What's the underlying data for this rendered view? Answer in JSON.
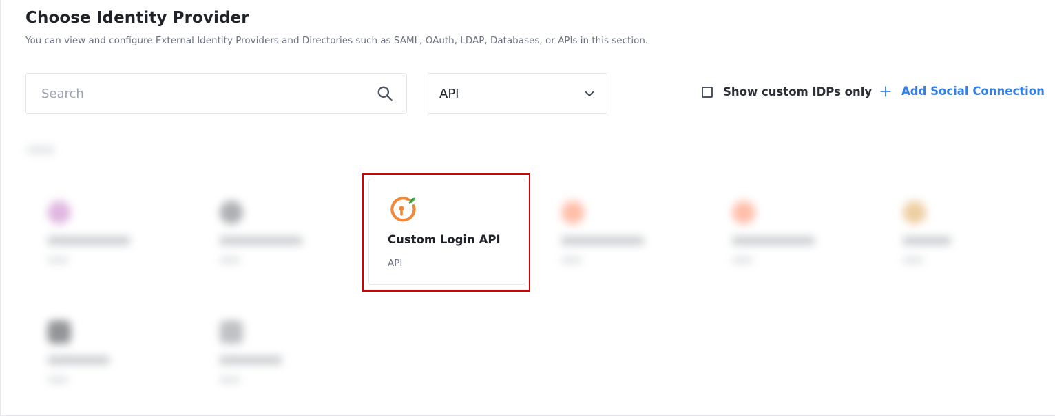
{
  "header": {
    "title": "Choose Identity Provider",
    "subtitle": "You can view and configure External Identity Providers and Directories such as SAML, OAuth, LDAP, Databases, or APIs in this section."
  },
  "toolbar": {
    "search": {
      "placeholder": "Search",
      "value": "",
      "icon": "search-icon"
    },
    "type_filter": {
      "selected": "API",
      "icon": "chevron-down-icon"
    },
    "show_custom": {
      "label": "Show custom IDPs only",
      "checked": false
    },
    "add_social": {
      "label": "Add Social Connection",
      "icon": "plus-icon"
    }
  },
  "cards": [
    {
      "name": "Custom Login API",
      "type": "API",
      "icon": "keyhole-icon",
      "highlighted": true
    }
  ],
  "colors": {
    "accent": "#2f80ed",
    "highlight_border": "#d50000",
    "logo_orange": "#f08a3a",
    "logo_green": "#4caf50"
  }
}
